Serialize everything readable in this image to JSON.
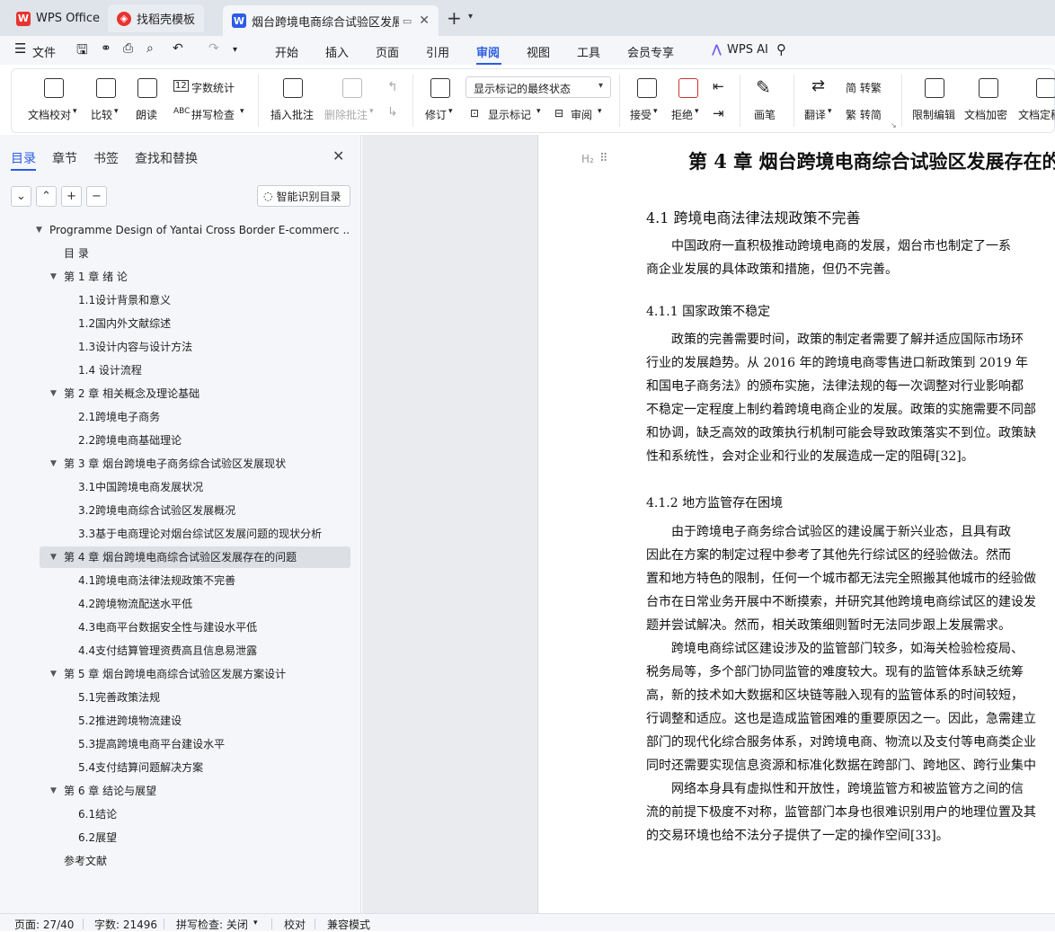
{
  "tabs": {
    "wps": "WPS Office",
    "template": "找稻壳模板",
    "doc": "烟台跨境电商综合试验区发展方"
  },
  "menu": {
    "file": "文件",
    "items": [
      "开始",
      "插入",
      "页面",
      "引用",
      "审阅",
      "视图",
      "工具",
      "会员专享"
    ],
    "ai": "WPS AI"
  },
  "ribbon": {
    "proofread": "文档校对",
    "compare": "比较",
    "read": "朗读",
    "wordcount": "字数统计",
    "spellcheck": "拼写检查",
    "insert_comment": "插入批注",
    "delete_comment": "删除批注",
    "track": "修订",
    "display_state": "显示标记的最终状态",
    "show_markup": "显示标记",
    "review": "审阅",
    "accept": "接受",
    "reject": "拒绝",
    "pen": "画笔",
    "translate": "翻译",
    "simp_trad": "简 转繁",
    "trad_simp": "繁 转简",
    "restrict": "限制编辑",
    "encrypt": "文档加密",
    "finalize": "文档定稿"
  },
  "sidebar": {
    "tabs": [
      "目录",
      "章节",
      "书签",
      "查找和替换"
    ],
    "smart_toc": "智能识别目录",
    "toc": [
      {
        "label": "Programme Design of Yantai Cross Border E-commerc ...",
        "level": 0,
        "expand": true
      },
      {
        "label": "目 录",
        "level": 1,
        "expand": false
      },
      {
        "label": "第 1 章 绪 论",
        "level": 1,
        "expand": true
      },
      {
        "label": "1.1设计背景和意义",
        "level": 2,
        "expand": false
      },
      {
        "label": "1.2国内外文献综述",
        "level": 2,
        "expand": false
      },
      {
        "label": "1.3设计内容与设计方法",
        "level": 2,
        "expand": false
      },
      {
        "label": "1.4 设计流程",
        "level": 2,
        "expand": false
      },
      {
        "label": "第 2 章 相关概念及理论基础",
        "level": 1,
        "expand": true
      },
      {
        "label": "2.1跨境电子商务",
        "level": 2,
        "expand": false
      },
      {
        "label": "2.2跨境电商基础理论",
        "level": 2,
        "expand": false
      },
      {
        "label": "第 3 章 烟台跨境电子商务综合试验区发展现状",
        "level": 1,
        "expand": true
      },
      {
        "label": "3.1中国跨境电商发展状况",
        "level": 2,
        "expand": false
      },
      {
        "label": "3.2跨境电商综合试验区发展概况",
        "level": 2,
        "expand": false
      },
      {
        "label": "3.3基于电商理论对烟台综试区发展问题的现状分析",
        "level": 2,
        "expand": false
      },
      {
        "label": "第 4 章 烟台跨境电商综合试验区发展存在的问题",
        "level": 1,
        "expand": true,
        "selected": true
      },
      {
        "label": "4.1跨境电商法律法规政策不完善",
        "level": 2,
        "expand": false
      },
      {
        "label": "4.2跨境物流配送水平低",
        "level": 2,
        "expand": false
      },
      {
        "label": "4.3电商平台数据安全性与建设水平低",
        "level": 2,
        "expand": false
      },
      {
        "label": "4.4支付结算管理资费高且信息易泄露",
        "level": 2,
        "expand": false
      },
      {
        "label": "第 5 章 烟台跨境电商综合试验区发展方案设计",
        "level": 1,
        "expand": true
      },
      {
        "label": "5.1完善政策法规",
        "level": 2,
        "expand": false
      },
      {
        "label": "5.2推进跨境物流建设",
        "level": 2,
        "expand": false
      },
      {
        "label": "5.3提高跨境电商平台建设水平",
        "level": 2,
        "expand": false
      },
      {
        "label": "5.4支付结算问题解决方案",
        "level": 2,
        "expand": false
      },
      {
        "label": "第 6 章 结论与展望",
        "level": 1,
        "expand": true
      },
      {
        "label": "6.1结论",
        "level": 2,
        "expand": false
      },
      {
        "label": "6.2展望",
        "level": 2,
        "expand": false
      },
      {
        "label": "参考文献",
        "level": 1,
        "expand": false
      }
    ]
  },
  "document": {
    "heading_marker": "H₂",
    "chapter_title": "第 4 章 烟台跨境电商综合试验区发展存在的",
    "sec_4_1": "4.1  跨境电商法律法规政策不完善",
    "p1": [
      "中国政府一直积极推动跨境电商的发展，烟台市也制定了一系",
      "商企业发展的具体政策和措施，但仍不完善。"
    ],
    "sec_4_1_1": "4.1.1  国家政策不稳定",
    "p2": [
      "政策的完善需要时间，政策的制定者需要了解并适应国际市场环",
      "行业的发展趋势。从 2016 年的跨境电商零售进口新政策到  2019 年",
      "和国电子商务法》的颁布实施，法律法规的每一次调整对行业影响都",
      "不稳定一定程度上制约着跨境电商企业的发展。政策的实施需要不同部",
      "和协调，缺乏高效的政策执行机制可能会导致政策落实不到位。政策缺",
      "性和系统性，会对企业和行业的发展造成一定的阻碍[32]。"
    ],
    "sec_4_1_2": "4.1.2  地方监管存在困境",
    "p3": [
      "由于跨境电子商务综合试验区的建设属于新兴业态，且具有政",
      "因此在方案的制定过程中参考了其他先行综试区的经验做法。然而",
      "置和地方特色的限制，任何一个城市都无法完全照搬其他城市的经验做",
      "台市在日常业务开展中不断摸索，并研究其他跨境电商综试区的建设发",
      "题并尝试解决。然而，相关政策细则暂时无法同步跟上发展需求。"
    ],
    "p4": [
      "跨境电商综试区建设涉及的监管部门较多，如海关检验检疫局、",
      "税务局等，多个部门协同监管的难度较大。现有的监管体系缺乏统筹",
      "高，新的技术如大数据和区块链等融入现有的监管体系的时间较短，",
      "行调整和适应。这也是造成监管困难的重要原因之一。因此，急需建立",
      "部门的现代化综合服务体系，对跨境电商、物流以及支付等电商类企业",
      "同时还需要实现信息资源和标准化数据在跨部门、跨地区、跨行业集中"
    ],
    "p5": [
      "网络本身具有虚拟性和开放性，跨境监管方和被监管方之间的信",
      "流的前提下极度不对称，监管部门本身也很难识别用户的地理位置及其",
      "的交易环境也给不法分子提供了一定的操作空间[33]。"
    ]
  },
  "status": {
    "page": "页面: 27/40",
    "words": "字数: 21496",
    "spell": "拼写检查: 关闭",
    "proof": "校对",
    "compat": "兼容模式"
  },
  "colors": {
    "accent": "#2b5ce6",
    "wps_red": "#e8332f"
  }
}
